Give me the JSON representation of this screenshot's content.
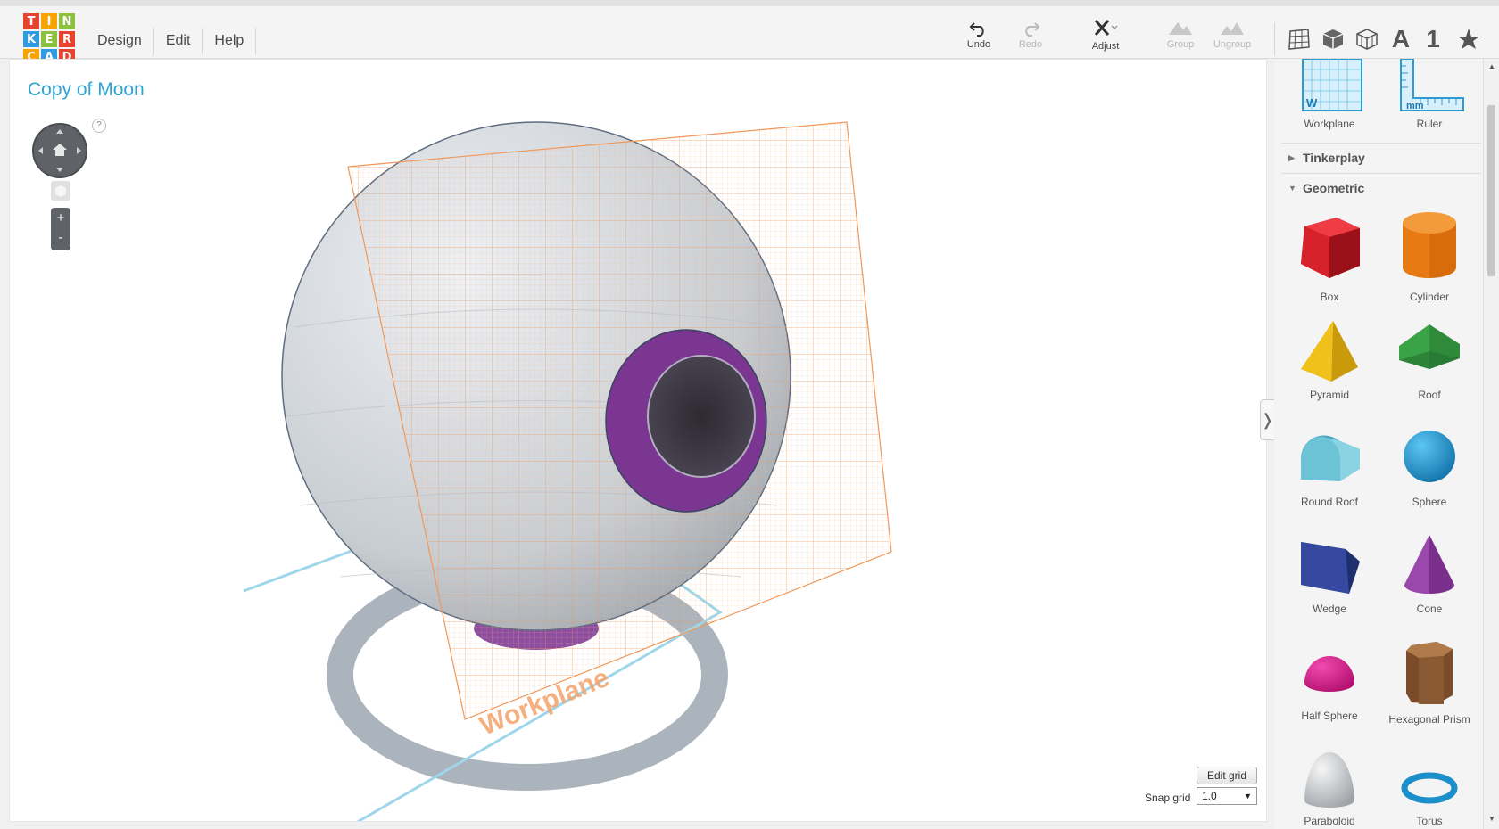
{
  "logo": {
    "letters": [
      "T",
      "I",
      "N",
      "K",
      "E",
      "R",
      "C",
      "A",
      "D"
    ],
    "colors": [
      "#e8432f",
      "#f7a400",
      "#8cc23f",
      "#2f9be0",
      "#8cc23f",
      "#e8432f",
      "#f7a400",
      "#2f9be0",
      "#e8432f"
    ]
  },
  "menu": [
    "Design",
    "Edit",
    "Help"
  ],
  "toolbar": {
    "undo": "Undo",
    "redo": "Redo",
    "adjust": "Adjust",
    "group": "Group",
    "ungroup": "Ungroup",
    "text_icon": "A",
    "number_icon": "1"
  },
  "canvas": {
    "title": "Copy of Moon",
    "help": "?",
    "zoom_in": "+",
    "zoom_out": "-",
    "workplane_label": "Workplane",
    "edit_grid": "Edit grid",
    "snap_label": "Snap grid",
    "snap_value": "1.0",
    "collapse": "❭"
  },
  "sidebar": {
    "helpers": [
      {
        "label": "Workplane",
        "icon": "workplane-icon"
      },
      {
        "label": "Ruler",
        "icon": "ruler-icon"
      }
    ],
    "sections": [
      {
        "label": "Tinkerplay",
        "expanded": false
      },
      {
        "label": "Geometric",
        "expanded": true
      }
    ],
    "shapes": [
      {
        "label": "Box",
        "color": "#d8222b"
      },
      {
        "label": "Cylinder",
        "color": "#e77a12"
      },
      {
        "label": "Pyramid",
        "color": "#f0c11a"
      },
      {
        "label": "Roof",
        "color": "#3aa247"
      },
      {
        "label": "Round Roof",
        "color": "#6cc3d6"
      },
      {
        "label": "Sphere",
        "color": "#1d9ad6"
      },
      {
        "label": "Wedge",
        "color": "#2a3f8f"
      },
      {
        "label": "Cone",
        "color": "#8a3a9c"
      },
      {
        "label": "Half Sphere",
        "color": "#e0178a"
      },
      {
        "label": "Hexagonal Prism",
        "color": "#8a5a34"
      },
      {
        "label": "Paraboloid",
        "color": "#d8d8d8"
      },
      {
        "label": "Torus",
        "color": "#1a8fc9"
      }
    ]
  }
}
